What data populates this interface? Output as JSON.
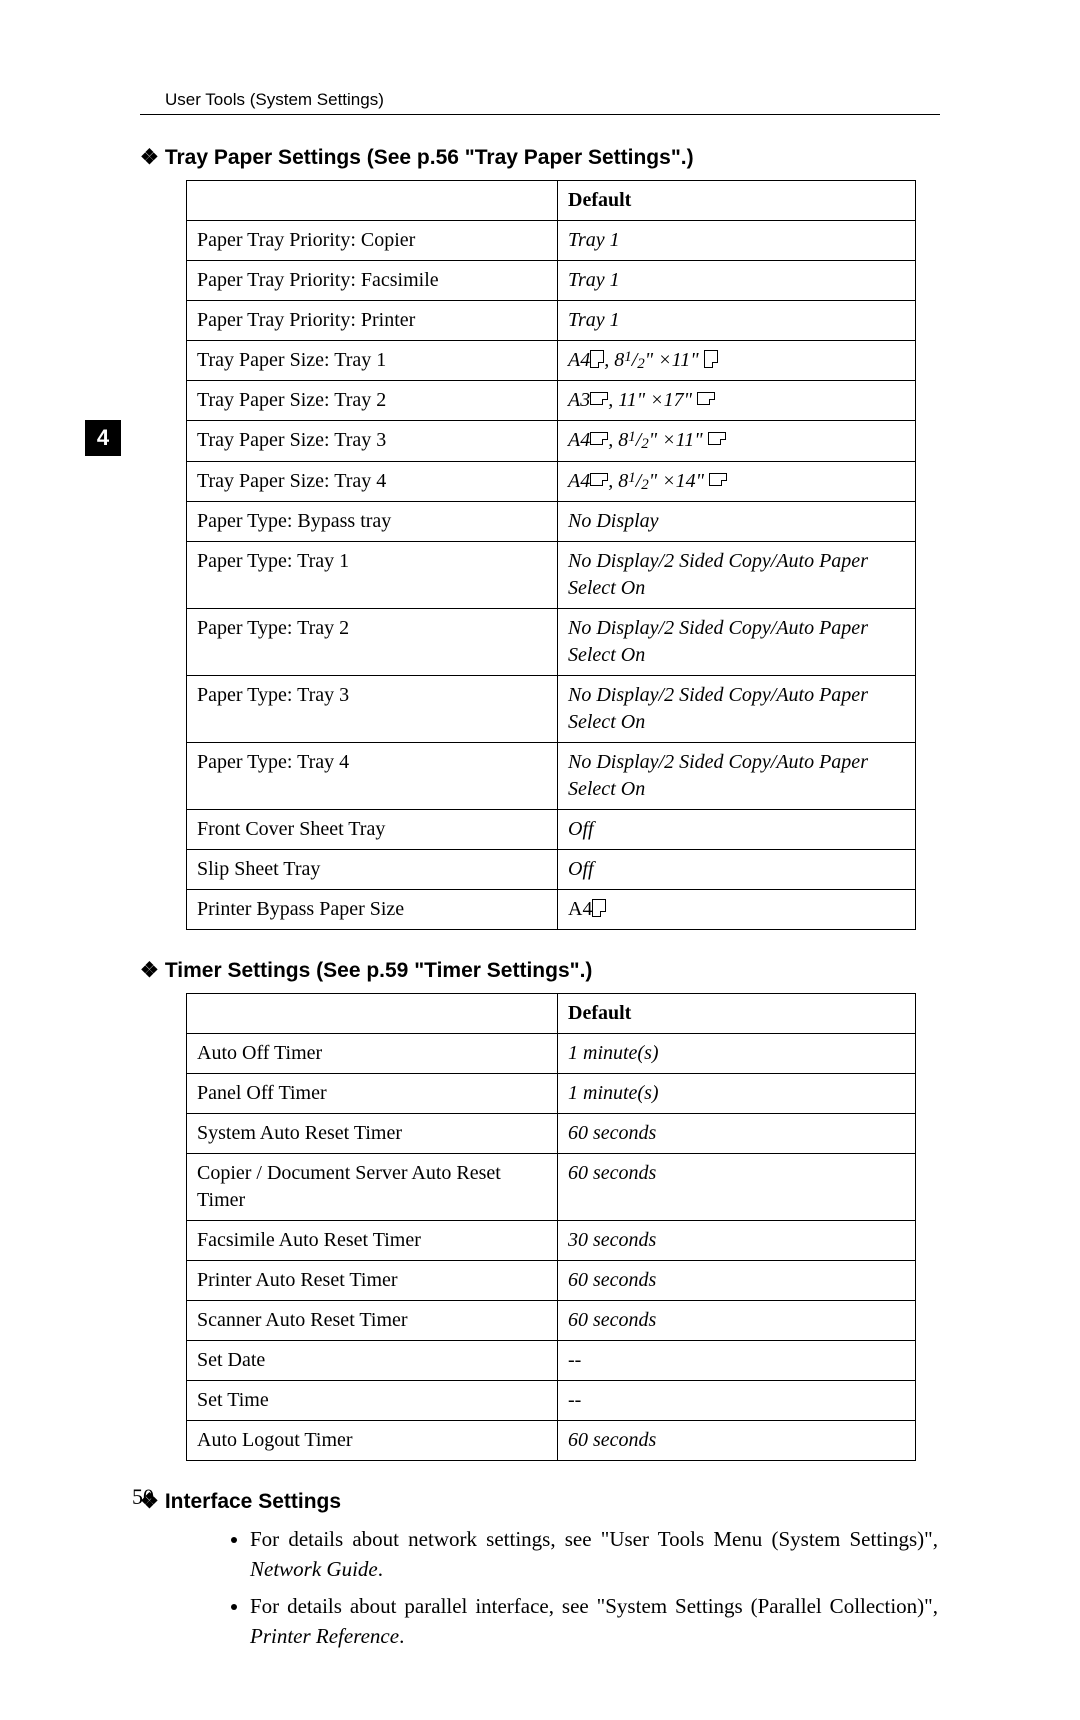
{
  "header": {
    "running": "User Tools (System Settings)"
  },
  "chapter": {
    "number": "4"
  },
  "pageNumber": "50",
  "sections": [
    {
      "title": "Tray Paper Settings (See p.56 \"Tray Paper Settings\".)",
      "headerBlank": "",
      "headerDefault": "Default",
      "rows": [
        {
          "name": "Paper Tray Priority: Copier",
          "def": {
            "type": "italic",
            "text": "Tray 1"
          }
        },
        {
          "name": "Paper Tray Priority: Facsimile",
          "def": {
            "type": "italic",
            "text": "Tray 1"
          }
        },
        {
          "name": "Paper Tray Priority: Printer",
          "def": {
            "type": "italic",
            "text": "Tray 1"
          }
        },
        {
          "name": "Tray Paper Size: Tray 1",
          "def": {
            "type": "size",
            "a": {
              "label": "A4",
              "orient": "portrait"
            },
            "b": {
              "num": "8",
              "upper": "1",
              "lower": "2",
              "mult": "11",
              "orient": "portrait"
            }
          }
        },
        {
          "name": "Tray Paper Size: Tray 2",
          "def": {
            "type": "size2",
            "a": {
              "label": "A3",
              "orient": "landscape"
            },
            "b": {
              "w": "11",
              "h": "17",
              "orient": "landscape"
            }
          }
        },
        {
          "name": "Tray Paper Size: Tray 3",
          "def": {
            "type": "size",
            "a": {
              "label": "A4",
              "orient": "landscape"
            },
            "b": {
              "num": "8",
              "upper": "1",
              "lower": "2",
              "mult": "11",
              "orient": "landscape"
            }
          }
        },
        {
          "name": "Tray Paper Size: Tray 4",
          "def": {
            "type": "size",
            "a": {
              "label": "A4",
              "orient": "landscape"
            },
            "b": {
              "num": "8",
              "upper": "1",
              "lower": "2",
              "mult": "14",
              "orient": "landscape"
            }
          }
        },
        {
          "name": "Paper Type: Bypass tray",
          "def": {
            "type": "italic",
            "text": "No Display"
          }
        },
        {
          "name": "Paper Type: Tray 1",
          "def": {
            "type": "italic",
            "text": "No Display/2 Sided Copy/Auto Paper Select On"
          }
        },
        {
          "name": "Paper Type: Tray 2",
          "def": {
            "type": "italic",
            "text": "No Display/2 Sided Copy/Auto Paper Select On"
          }
        },
        {
          "name": "Paper Type: Tray 3",
          "def": {
            "type": "italic",
            "text": "No Display/2 Sided Copy/Auto Paper Select On"
          }
        },
        {
          "name": "Paper Type: Tray 4",
          "def": {
            "type": "italic",
            "text": "No Display/2 Sided Copy/Auto Paper Select On"
          }
        },
        {
          "name": "Front Cover Sheet Tray",
          "def": {
            "type": "italic",
            "text": "Off"
          }
        },
        {
          "name": "Slip Sheet Tray",
          "def": {
            "type": "italic",
            "text": "Off"
          }
        },
        {
          "name": "Printer Bypass Paper Size",
          "def": {
            "type": "plainorient",
            "text": "A4",
            "orient": "portrait"
          }
        }
      ]
    },
    {
      "title": "Timer Settings (See p.59 \"Timer Settings\".)",
      "headerBlank": "",
      "headerDefault": "Default",
      "rows": [
        {
          "name": "Auto Off Timer",
          "def": {
            "type": "italic",
            "text": "1 minute(s)"
          }
        },
        {
          "name": "Panel Off Timer",
          "def": {
            "type": "italic",
            "text": "1 minute(s)"
          }
        },
        {
          "name": "System Auto Reset Timer",
          "def": {
            "type": "italic",
            "text": "60 seconds"
          }
        },
        {
          "name": "Copier / Document Server Auto Reset Timer",
          "def": {
            "type": "italic",
            "text": "60 seconds"
          }
        },
        {
          "name": "Facsimile Auto Reset Timer",
          "def": {
            "type": "italic",
            "text": "30 seconds"
          }
        },
        {
          "name": "Printer Auto Reset Timer",
          "def": {
            "type": "italic",
            "text": "60 seconds"
          }
        },
        {
          "name": "Scanner Auto Reset Timer",
          "def": {
            "type": "italic",
            "text": "60 seconds"
          }
        },
        {
          "name": "Set Date",
          "def": {
            "type": "plain",
            "text": "--"
          }
        },
        {
          "name": "Set Time",
          "def": {
            "type": "plain",
            "text": "--"
          }
        },
        {
          "name": "Auto Logout Timer",
          "def": {
            "type": "italic",
            "text": "60 seconds"
          }
        }
      ]
    }
  ],
  "interface": {
    "title": "Interface Settings",
    "bullets": [
      {
        "pre": "For details about network settings, see \"User Tools Menu (System Settings)\", ",
        "ital": "Network Guide",
        "post": "."
      },
      {
        "pre": "For details about parallel interface, see \"System Settings (Parallel Collection)\", ",
        "ital": "Printer Reference",
        "post": "."
      }
    ]
  }
}
